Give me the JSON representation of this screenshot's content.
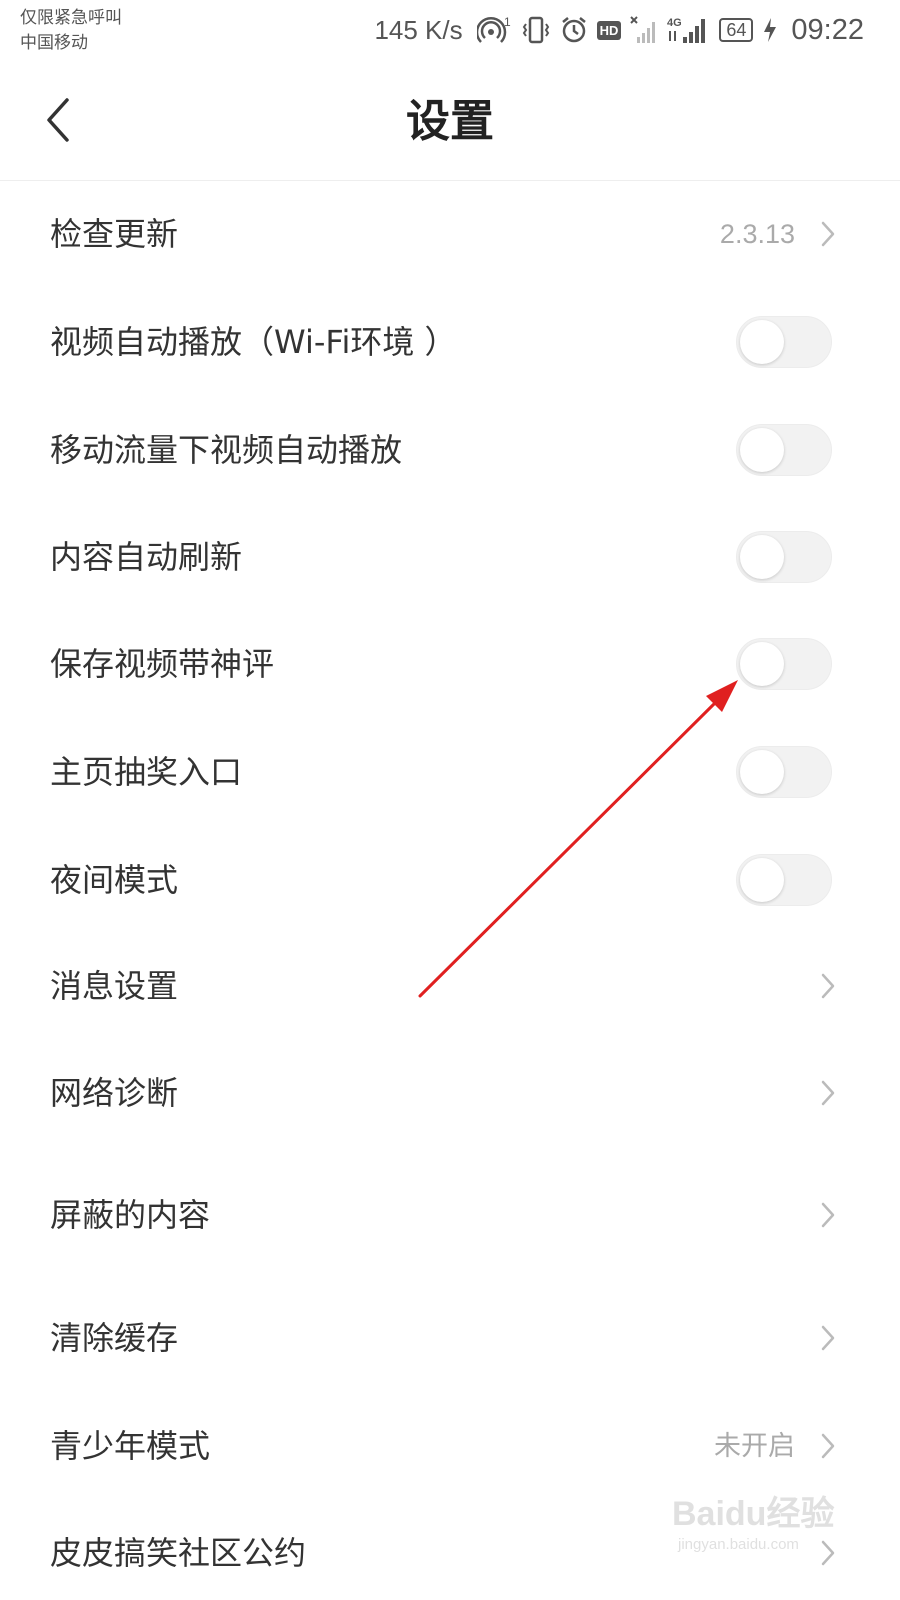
{
  "status_bar": {
    "carrier_line1": "仅限紧急呼叫",
    "carrier_line2": "中国移动",
    "net_speed": "145 K/s",
    "hotspot_badge": "1",
    "hd_label": "HD",
    "network_type": "4G",
    "battery": "64",
    "time": "09:22",
    "icons": [
      "hotspot-icon",
      "vibrate-icon",
      "alarm-icon",
      "hd-icon",
      "no-signal-icon",
      "signal-4g-icon",
      "battery-icon",
      "charging-icon"
    ]
  },
  "header": {
    "title": "设置",
    "back_icon": "chevron-left-icon"
  },
  "settings": [
    {
      "label": "检查更新",
      "value": "2.3.13",
      "control": "chevron"
    },
    {
      "label": "视频自动播放（Wi-Fi环境 ）",
      "control": "toggle",
      "on": false
    },
    {
      "label": "移动流量下视频自动播放",
      "control": "toggle",
      "on": false
    },
    {
      "label": "内容自动刷新",
      "control": "toggle",
      "on": false
    },
    {
      "label": "保存视频带神评",
      "control": "toggle",
      "on": false
    },
    {
      "label": "主页抽奖入口",
      "control": "toggle",
      "on": false
    },
    {
      "label": "夜间模式",
      "control": "toggle",
      "on": false
    },
    {
      "label": "消息设置",
      "control": "chevron"
    },
    {
      "label": "网络诊断",
      "control": "chevron"
    },
    {
      "label": "屏蔽的内容",
      "control": "chevron"
    },
    {
      "label": "清除缓存",
      "control": "chevron"
    },
    {
      "label": "青少年模式",
      "value": "未开启",
      "control": "chevron"
    },
    {
      "label": "皮皮搞笑社区公约",
      "control": "chevron"
    }
  ],
  "annotation": {
    "color": "#e02020",
    "target": "保存视频带神评"
  },
  "watermark": {
    "brand": "Baidu经验",
    "url": "jingyan.baidu.com"
  }
}
